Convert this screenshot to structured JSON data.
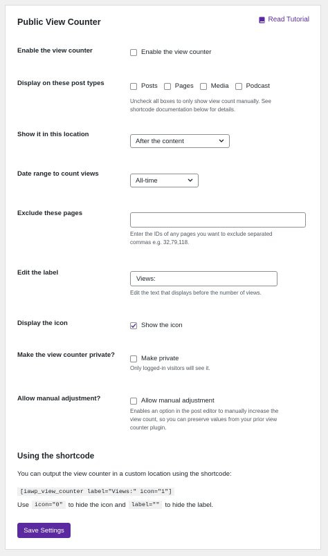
{
  "header": {
    "title": "Public View Counter",
    "tutorial_label": "Read Tutorial"
  },
  "rows": {
    "enable": {
      "label": "Enable the view counter",
      "checkbox_label": "Enable the view counter",
      "checked": false
    },
    "post_types": {
      "label": "Display on these post types",
      "options": [
        "Posts",
        "Pages",
        "Media",
        "Podcast"
      ],
      "help_line1": "Uncheck all boxes to only show view count manually. See",
      "help_line2": "shortcode documentation below for details."
    },
    "location": {
      "label": "Show it in this location",
      "selected": "After the content"
    },
    "date_range": {
      "label": "Date range to count views",
      "selected": "All-time"
    },
    "exclude": {
      "label": "Exclude these pages",
      "value": "",
      "help_line1": "Enter the IDs of any pages you want to exclude separated",
      "help_line2": "commas e.g. 32,79,118."
    },
    "edit_label": {
      "label": "Edit the label",
      "value": "Views:",
      "help": "Edit the text that displays before the number of views."
    },
    "icon": {
      "label": "Display the icon",
      "checkbox_label": "Show the icon",
      "checked": true
    },
    "private": {
      "label": "Make the view counter private?",
      "checkbox_label": "Make private",
      "help": "Only logged-in visitors will see it.",
      "checked": false
    },
    "manual": {
      "label": "Allow manual adjustment?",
      "checkbox_label": "Allow manual adjustment",
      "help_line1": "Enables an option in the post editor to manually increase the",
      "help_line2": "view count, so you can preserve values from your prior view",
      "help_line3": "counter plugin.",
      "checked": false
    }
  },
  "shortcode": {
    "title": "Using the shortcode",
    "intro": "You can output the view counter in a custom location using the shortcode:",
    "code": "[iawp_view_counter label=\"Views:\" icon=\"1\"]",
    "use_prefix": "Use",
    "code_icon": "icon=\"0\"",
    "use_middle": "to hide the icon and",
    "code_label": "label=\"\"",
    "use_suffix": "to hide the label."
  },
  "save_label": "Save Settings",
  "colors": {
    "accent": "#5b2aa0",
    "background": "#f0f0f1"
  }
}
